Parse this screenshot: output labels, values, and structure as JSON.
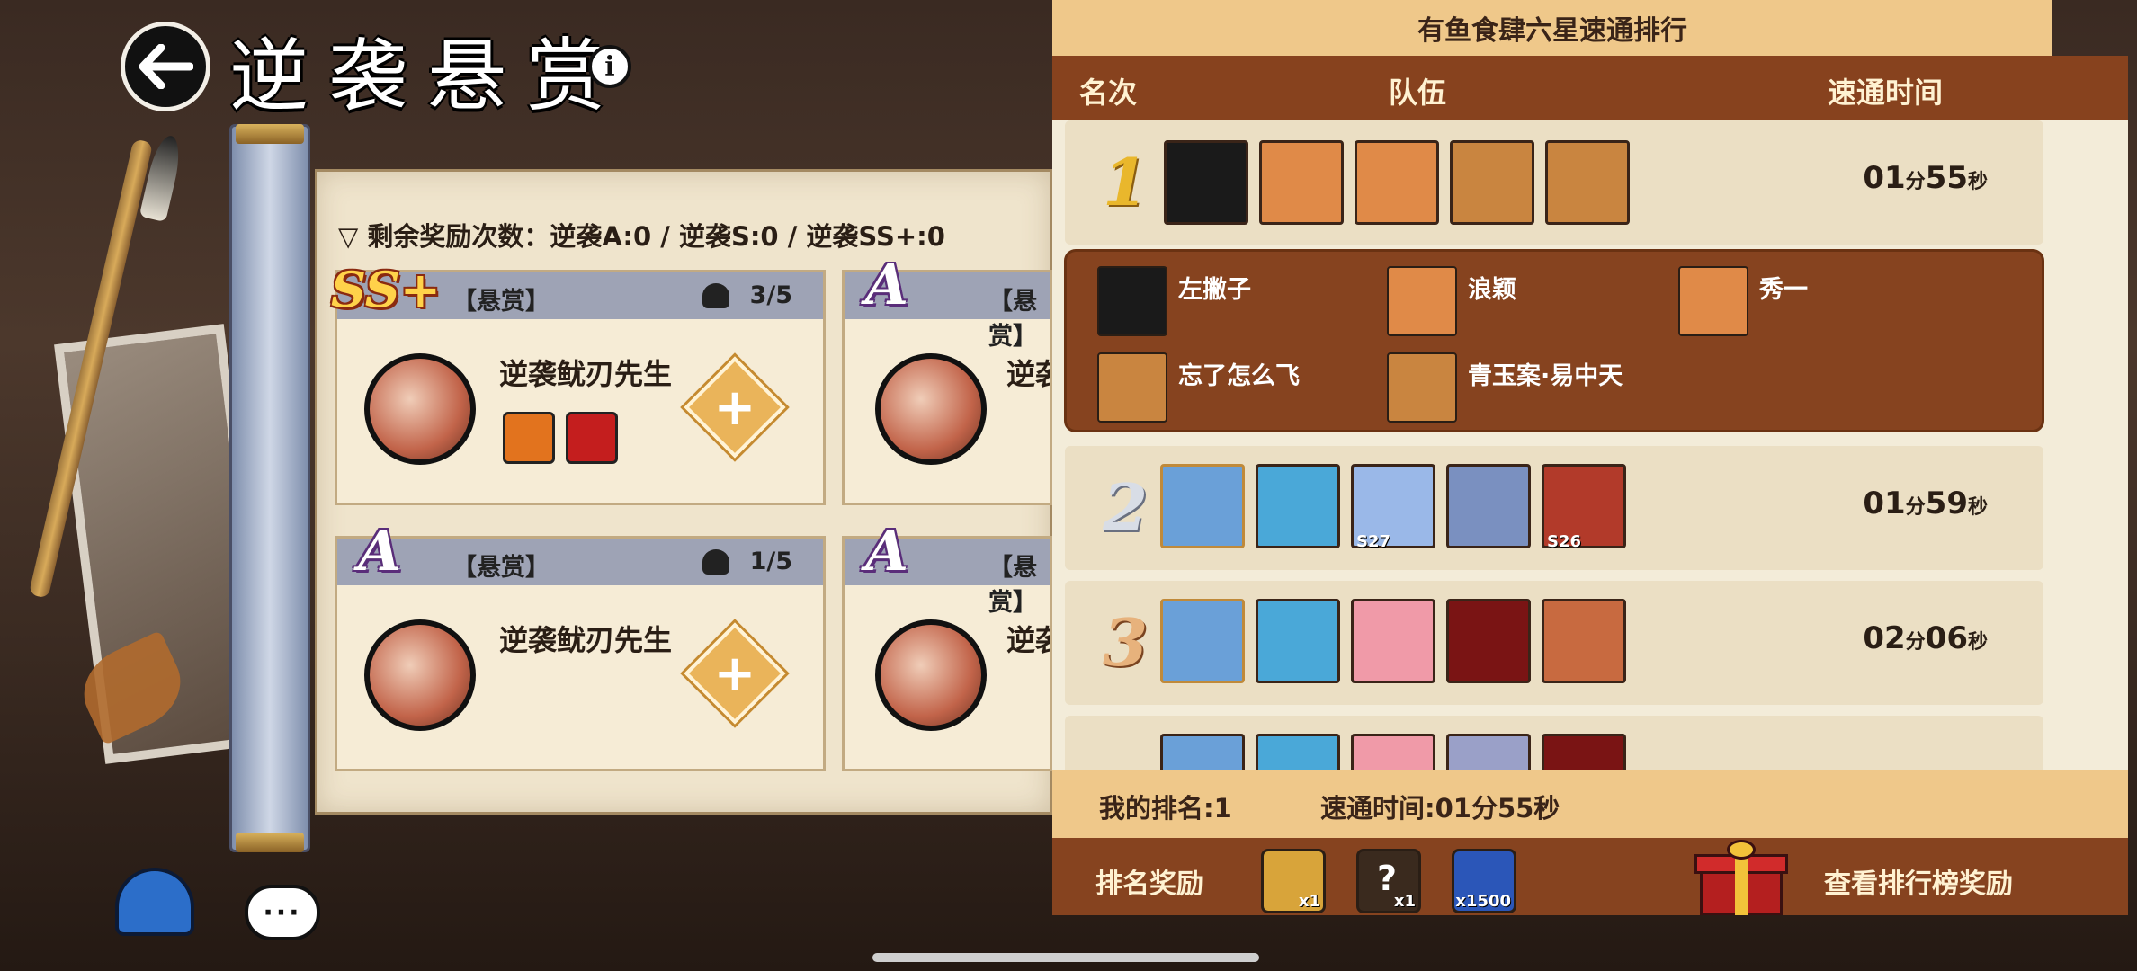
{
  "header": {
    "title": "逆袭悬赏",
    "info_label": "i"
  },
  "rewards_left": "剩余奖励次数：逆袭A:0 / 逆袭S:0 / 逆袭SS+:0",
  "cards": [
    {
      "rank": "SS+",
      "tag": "【悬赏】",
      "count": "3/5",
      "boss": "逆袭鱿刃先生"
    },
    {
      "rank": "A",
      "tag": "【悬赏】",
      "count": "",
      "boss": "逆袭"
    },
    {
      "rank": "A",
      "tag": "【悬赏】",
      "count": "1/5",
      "boss": "逆袭鱿刃先生"
    },
    {
      "rank": "A",
      "tag": "【悬赏】",
      "count": "",
      "boss": "逆袭"
    }
  ],
  "chat_icon_text": "···",
  "leaderboard": {
    "title": "有鱼食肆六星速通排行",
    "columns": {
      "rank": "名次",
      "team": "队伍",
      "time": "速通时间"
    },
    "rows": [
      {
        "rank": "1",
        "min": "01",
        "min_unit": "分",
        "sec": "55",
        "sec_unit": "秒",
        "members": [
          "左撇子",
          "浪颖",
          "秀一",
          "忘了怎么飞",
          "青玉案·易中天"
        ]
      },
      {
        "rank": "2",
        "min": "01",
        "min_unit": "分",
        "sec": "59",
        "sec_unit": "秒",
        "levels": [
          "S27",
          "S26"
        ]
      },
      {
        "rank": "3",
        "min": "02",
        "min_unit": "分",
        "sec": "06",
        "sec_unit": "秒"
      }
    ],
    "my_rank": "我的排名:1",
    "my_time": "速通时间:01分55秒",
    "reward_label": "排名奖励",
    "reward_items": [
      {
        "name": "scroll-reward",
        "qty": "x1",
        "color": "#d8a43a"
      },
      {
        "name": "mystery-reward",
        "qty": "x1",
        "color": "#3a2a1e"
      },
      {
        "name": "figure-reward",
        "qty": "x1500",
        "color": "#2b56b8"
      }
    ],
    "view_rewards": "查看排行榜奖励"
  },
  "colors": {
    "accent_brown": "#86431f",
    "header_gold": "#efc88a",
    "card_bg": "#f6ecd6"
  }
}
